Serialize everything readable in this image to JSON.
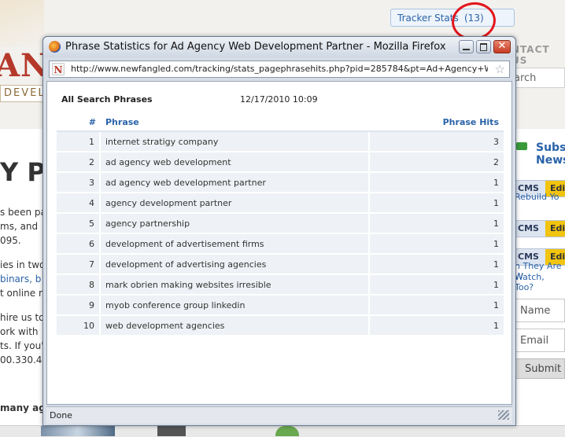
{
  "background": {
    "logo_text": "ANG",
    "logo_sub": "DEVEL",
    "tracker_label": "Tracker Stats",
    "tracker_count": "(13)",
    "contact": "NTACT US",
    "search_placeholder": "arch",
    "hero": "Y PA",
    "paragraphs": [
      "s been pa",
      "ms, and",
      "095.",
      "ies in two",
      "binars, b",
      "t online r",
      "hire us to",
      "ork with",
      "ts. If you'",
      "00.330.4"
    ],
    "bold_line": "many ag",
    "subscribe_line1": "Subsc",
    "subscribe_line2": "News",
    "cms_label": "CMS",
    "edit_label": "Edit",
    "rebuild_text": "Rebuild Yo",
    "they_text": "n They Are W",
    "watch_text": "Watch, Too?",
    "name_field": "Name",
    "email_field": "Email",
    "submit_label": "Submit"
  },
  "window": {
    "title": "Phrase Statistics for Ad Agency Web Development Partner - Mozilla Firefox",
    "url": "http://www.newfangled.com/tracking/stats_pagephrasehits.php?pid=285784&pt=Ad+Agency+Web+Develo",
    "report_title": "All Search Phrases",
    "report_date": "12/17/2010 10:09",
    "status": "Done"
  },
  "table": {
    "headers": {
      "num": "#",
      "phrase": "Phrase",
      "hits": "Phrase Hits"
    },
    "rows": [
      {
        "num": "1",
        "phrase": "internet stratigy company",
        "hits": "3"
      },
      {
        "num": "2",
        "phrase": "ad agency web development",
        "hits": "2"
      },
      {
        "num": "3",
        "phrase": "ad agency web development partner",
        "hits": "1"
      },
      {
        "num": "4",
        "phrase": "agency development partner",
        "hits": "1"
      },
      {
        "num": "5",
        "phrase": "agency partnership",
        "hits": "1"
      },
      {
        "num": "6",
        "phrase": "development of advertisement firms",
        "hits": "1"
      },
      {
        "num": "7",
        "phrase": "development of advertising agencies",
        "hits": "1"
      },
      {
        "num": "8",
        "phrase": "mark obrien making websites irresible",
        "hits": "1"
      },
      {
        "num": "9",
        "phrase": "myob conference group linkedin",
        "hits": "1"
      },
      {
        "num": "10",
        "phrase": "web development agencies",
        "hits": "1"
      }
    ]
  },
  "colors": {
    "accent": "#2a62a8",
    "highlight_circle": "#e3141b",
    "close_button": "#c63b22"
  }
}
